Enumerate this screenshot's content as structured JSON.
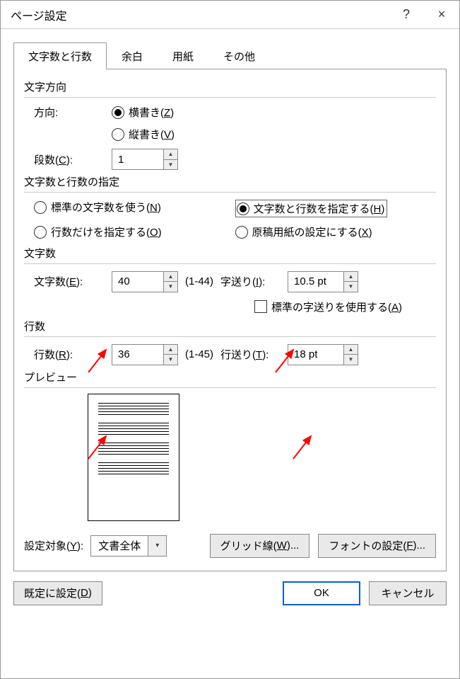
{
  "window": {
    "title": "ページ設定",
    "help": "?",
    "close": "×"
  },
  "tabs": {
    "t1": "文字数と行数",
    "t2": "余白",
    "t3": "用紙",
    "t4": "その他"
  },
  "direction": {
    "group": "文字方向",
    "label": "方向:",
    "horizontal": "横書き(",
    "horizontal_u": "Z",
    "horizontal_end": ")",
    "vertical": "縦書き(",
    "vertical_u": "V",
    "vertical_end": ")",
    "columns_label": "段数(",
    "columns_u": "C",
    "columns_end": "):",
    "columns_value": "1"
  },
  "spec": {
    "group": "文字数と行数の指定",
    "r1": "標準の文字数を使う(",
    "r1_u": "N",
    "r1_end": ")",
    "r2": "文字数と行数を指定する(",
    "r2_u": "H",
    "r2_end": ")",
    "r3": "行数だけを指定する(",
    "r3_u": "O",
    "r3_end": ")",
    "r4": "原稿用紙の設定にする(",
    "r4_u": "X",
    "r4_end": ")"
  },
  "chars": {
    "group": "文字数",
    "count_label": "文字数(",
    "count_u": "E",
    "count_end": "):",
    "count_value": "40",
    "count_range": "(1-44)",
    "pitch_label": "字送り(",
    "pitch_u": "I",
    "pitch_end": "):",
    "pitch_value": "10.5 pt",
    "default_pitch": "標準の字送りを使用する(",
    "default_pitch_u": "A",
    "default_pitch_end": ")"
  },
  "lines": {
    "group": "行数",
    "count_label": "行数(",
    "count_u": "R",
    "count_end": "):",
    "count_value": "36",
    "count_range": "(1-45)",
    "pitch_label": "行送り(",
    "pitch_u": "T",
    "pitch_end": "):",
    "pitch_value": "18 pt"
  },
  "preview": {
    "group": "プレビュー"
  },
  "apply": {
    "label": "設定対象(",
    "label_u": "Y",
    "label_end": "):",
    "value": "文書全体",
    "gridlines": "グリッド線(",
    "gridlines_u": "W",
    "gridlines_end": ")...",
    "font": "フォントの設定(",
    "font_u": "F",
    "font_end": ")..."
  },
  "buttons": {
    "default": "既定に設定(",
    "default_u": "D",
    "default_end": ")",
    "ok": "OK",
    "cancel": "キャンセル"
  }
}
